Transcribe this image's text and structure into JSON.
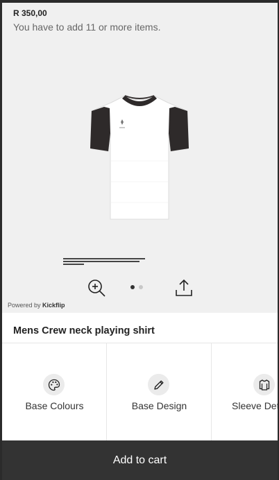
{
  "header": {
    "price": "R 350,00",
    "min_order_note": "You have to add 11 or more items."
  },
  "preview": {
    "zoom_icon": "zoom-in-icon",
    "share_icon": "share-icon",
    "image_count": 2,
    "active_image": 1,
    "powered_by_prefix": "Powered by ",
    "powered_by_brand": "Kickflip"
  },
  "product": {
    "title": "Mens Crew neck playing shirt"
  },
  "options": [
    {
      "label": "Base Colours",
      "icon": "palette-icon"
    },
    {
      "label": "Base Design",
      "icon": "pencil-icon"
    },
    {
      "label": "Sleeve Det",
      "icon": "shirt-icon"
    }
  ],
  "cart": {
    "label": "Add to cart"
  },
  "colors": {
    "preview_bg": "#f0f0f0",
    "cart_bg": "#333333",
    "shirt_body": "#ffffff",
    "shirt_sleeves": "#2e2a2a"
  }
}
